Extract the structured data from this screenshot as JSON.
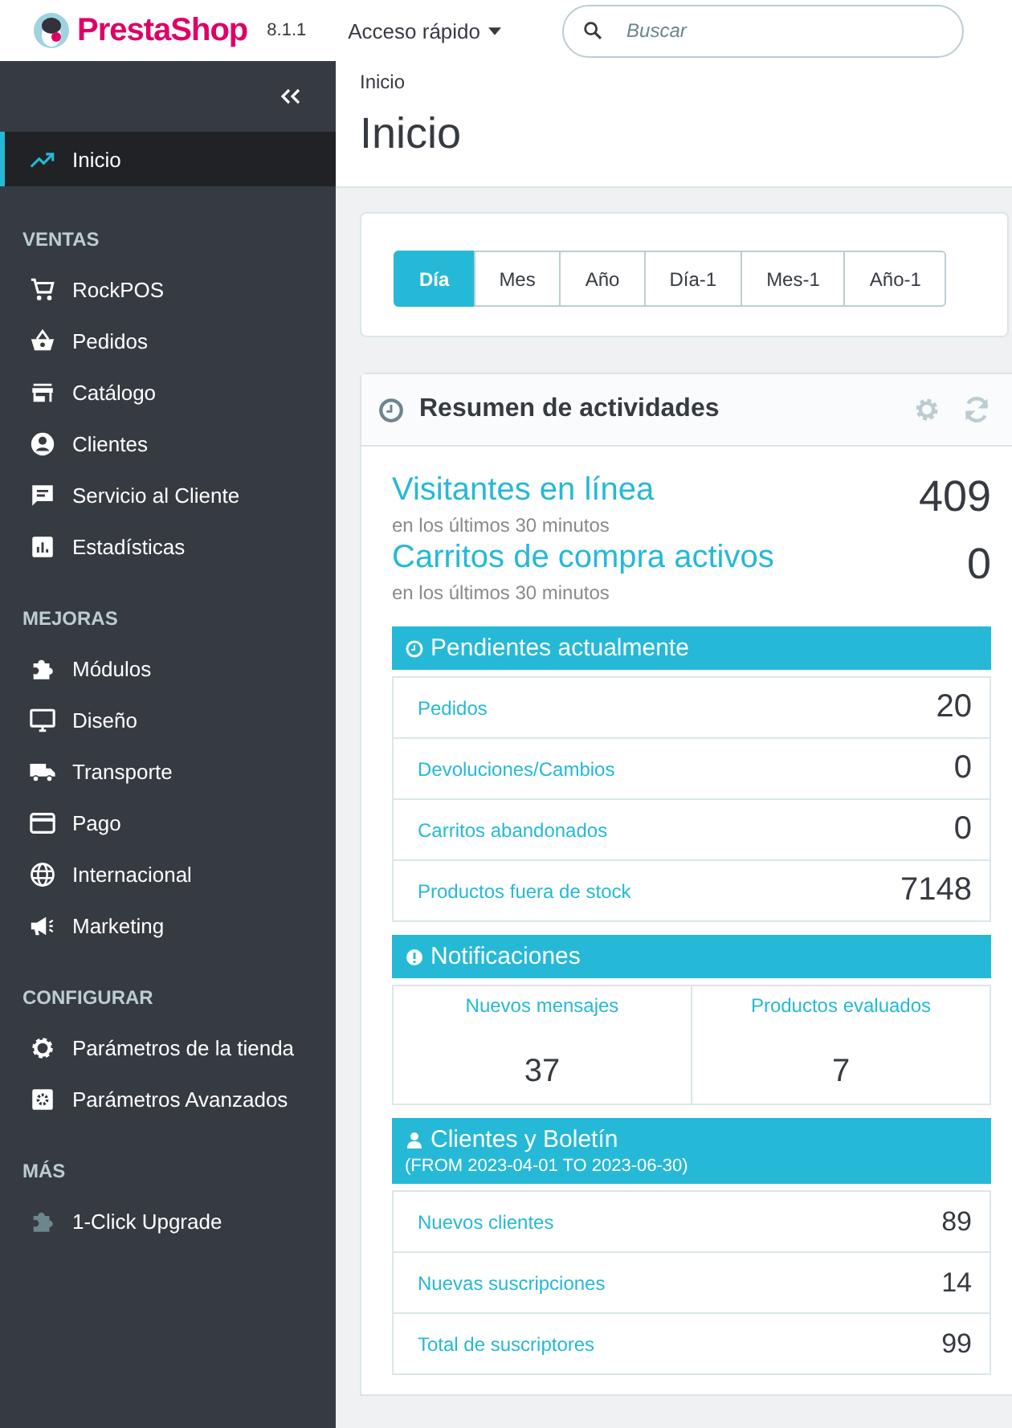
{
  "header": {
    "brand": "PrestaShop",
    "version": "8.1.1",
    "quick_access": "Acceso rápido",
    "search": {
      "placeholder": "Buscar"
    }
  },
  "sidebar": {
    "items": [
      {
        "label": "Inicio",
        "selected": true
      }
    ],
    "sections": [
      {
        "title": "VENTAS",
        "items": [
          {
            "label": "RockPOS",
            "selected": false
          },
          {
            "label": "Pedidos",
            "selected": false
          },
          {
            "label": "Catálogo",
            "selected": false
          },
          {
            "label": "Clientes",
            "selected": false
          },
          {
            "label": "Servicio al Cliente",
            "selected": false
          },
          {
            "label": "Estadísticas",
            "selected": false
          }
        ]
      },
      {
        "title": "MEJORAS",
        "items": [
          {
            "label": "Módulos",
            "selected": false
          },
          {
            "label": "Diseño",
            "selected": false
          },
          {
            "label": "Transporte",
            "selected": false
          },
          {
            "label": "Pago",
            "selected": false
          },
          {
            "label": "Internacional",
            "selected": false
          },
          {
            "label": "Marketing",
            "selected": false
          }
        ]
      },
      {
        "title": "CONFIGURAR",
        "items": [
          {
            "label": "Parámetros de la tienda",
            "selected": false
          },
          {
            "label": "Parámetros Avanzados",
            "selected": false
          }
        ]
      },
      {
        "title": "MÁS",
        "items": [
          {
            "label": "1-Click Upgrade",
            "selected": false
          }
        ]
      }
    ]
  },
  "breadcrumb": "Inicio",
  "page_title": "Inicio",
  "periods": [
    {
      "label": "Día",
      "selected": true
    },
    {
      "label": "Mes",
      "selected": false
    },
    {
      "label": "Año",
      "selected": false
    },
    {
      "label": "Día-1",
      "selected": false
    },
    {
      "label": "Mes-1",
      "selected": false
    },
    {
      "label": "Año-1",
      "selected": false
    }
  ],
  "activity": {
    "title": "Resumen de actividades",
    "stats": [
      {
        "label": "Visitantes en línea",
        "note": "en los últimos 30 minutos",
        "value": "409"
      },
      {
        "label": "Carritos de compra activos",
        "note": "en los últimos 30 minutos",
        "value": "0"
      }
    ],
    "pending": {
      "title": "Pendientes actualmente",
      "rows": [
        {
          "label": "Pedidos",
          "value": "20"
        },
        {
          "label": "Devoluciones/Cambios",
          "value": "0"
        },
        {
          "label": "Carritos abandonados",
          "value": "0"
        },
        {
          "label": "Productos fuera de stock",
          "value": "7148"
        }
      ]
    },
    "notifications": {
      "title": "Notificaciones",
      "cells": [
        {
          "label": "Nuevos mensajes",
          "value": "37"
        },
        {
          "label": "Productos evaluados",
          "value": "7"
        }
      ]
    },
    "customers": {
      "title": "Clientes y Boletín",
      "subtitle": "(FROM 2023-04-01 TO 2023-06-30)",
      "rows": [
        {
          "label": "Nuevos clientes",
          "value": "89"
        },
        {
          "label": "Nuevas suscripciones",
          "value": "14"
        },
        {
          "label": "Total de suscriptores",
          "value": "99"
        }
      ]
    }
  }
}
